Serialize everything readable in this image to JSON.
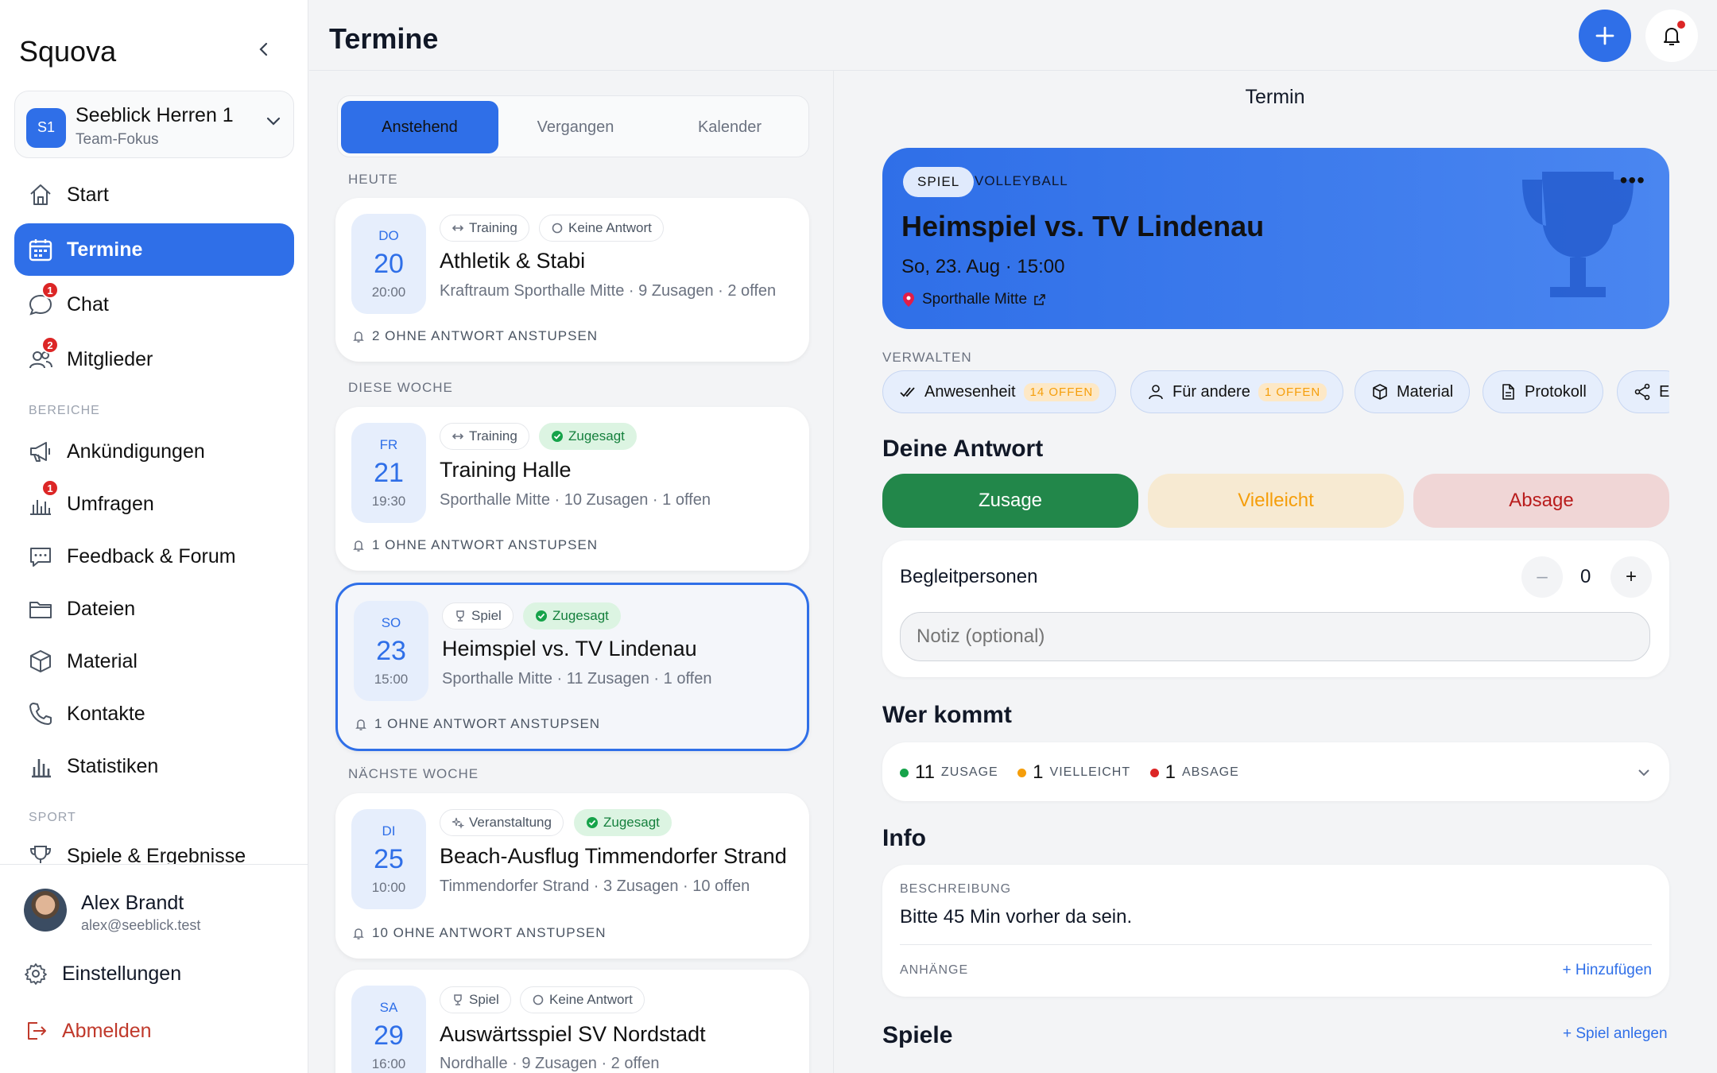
{
  "app": {
    "name": "Squova"
  },
  "team": {
    "badge": "S1",
    "name": "Seeblick Herren 1",
    "subtitle": "Team-Fokus"
  },
  "nav": {
    "items": [
      {
        "label": "Start",
        "icon": "home-icon"
      },
      {
        "label": "Termine",
        "icon": "calendar-icon",
        "active": true
      },
      {
        "label": "Chat",
        "icon": "chat-icon",
        "badge": "1"
      },
      {
        "label": "Mitglieder",
        "icon": "users-icon",
        "badge": "2"
      }
    ],
    "section_bereiche": "BEREICHE",
    "bereiche": [
      {
        "label": "Ankündigungen",
        "icon": "megaphone-icon"
      },
      {
        "label": "Umfragen",
        "icon": "poll-icon",
        "badge": "1"
      },
      {
        "label": "Feedback & Forum",
        "icon": "forum-icon"
      },
      {
        "label": "Dateien",
        "icon": "folder-icon"
      },
      {
        "label": "Material",
        "icon": "box-icon"
      },
      {
        "label": "Kontakte",
        "icon": "phone-icon"
      },
      {
        "label": "Statistiken",
        "icon": "stats-icon"
      }
    ],
    "section_sport": "SPORT",
    "sport": [
      {
        "label": "Spiele & Ergebnisse",
        "icon": "trophy-icon"
      }
    ]
  },
  "user": {
    "name": "Alex Brandt",
    "email": "alex@seeblick.test"
  },
  "bottom": {
    "settings": "Einstellungen",
    "logout": "Abmelden"
  },
  "header": {
    "title": "Termine"
  },
  "tabs": {
    "upcoming": "Anstehend",
    "past": "Vergangen",
    "calendar": "Kalender"
  },
  "groups": {
    "today": "HEUTE",
    "this_week": "DIESE WOCHE",
    "next_week": "NÄCHSTE WOCHE"
  },
  "events": [
    {
      "dow": "DO",
      "day": "20",
      "time": "20:00",
      "type": "Training",
      "status": "Keine Antwort",
      "title": "Athletik & Stabi",
      "meta": "Kraftraum Sporthalle Mitte · 9 Zusagen · 2 offen",
      "nudge": "2 OHNE ANTWORT ANSTUPSEN"
    },
    {
      "dow": "FR",
      "day": "21",
      "time": "19:30",
      "type": "Training",
      "status": "Zugesagt",
      "title": "Training Halle",
      "meta": "Sporthalle Mitte · 10 Zusagen · 1 offen",
      "nudge": "1 OHNE ANTWORT ANSTUPSEN"
    },
    {
      "dow": "SO",
      "day": "23",
      "time": "15:00",
      "type": "Spiel",
      "status": "Zugesagt",
      "title": "Heimspiel vs. TV Lindenau",
      "meta": "Sporthalle Mitte · 11 Zusagen · 1 offen",
      "nudge": "1 OHNE ANTWORT ANSTUPSEN"
    },
    {
      "dow": "DI",
      "day": "25",
      "time": "10:00",
      "type": "Veranstaltung",
      "status": "Zugesagt",
      "title": "Beach-Ausflug Timmendorfer Strand",
      "meta": "Timmendorfer Strand · 3 Zusagen · 10 offen",
      "nudge": "10 OHNE ANTWORT ANSTUPSEN"
    },
    {
      "dow": "SA",
      "day": "29",
      "time": "16:00",
      "type": "Spiel",
      "status": "Keine Antwort",
      "title": "Auswärtsspiel SV Nordstadt",
      "meta": "Nordhalle · 9 Zusagen · 2 offen"
    }
  ],
  "detail": {
    "heading": "Termin",
    "kind": "SPIEL",
    "sport": "VOLLEYBALL",
    "title": "Heimspiel vs. TV Lindenau",
    "datetime": "So, 23. Aug · 15:00",
    "location": "Sporthalle Mitte",
    "manage_label": "VERWALTEN",
    "actions": [
      {
        "label": "Anwesenheit",
        "count": "14 OFFEN",
        "icon": "check-icon"
      },
      {
        "label": "Für andere",
        "count": "1 OFFEN",
        "icon": "person-icon"
      },
      {
        "label": "Material",
        "icon": "box-icon"
      },
      {
        "label": "Protokoll",
        "icon": "document-icon"
      },
      {
        "label": "E",
        "icon": "share-icon"
      }
    ],
    "answer_heading": "Deine Antwort",
    "answers": {
      "yes": "Zusage",
      "maybe": "Vielleicht",
      "no": "Absage"
    },
    "companions_label": "Begleitpersonen",
    "companions_value": "0",
    "note_placeholder": "Notiz (optional)",
    "who_heading": "Wer kommt",
    "counts": {
      "yes_n": "11",
      "yes_l": "ZUSAGE",
      "maybe_n": "1",
      "maybe_l": "VIELLEICHT",
      "no_n": "1",
      "no_l": "ABSAGE"
    },
    "info_heading": "Info",
    "desc_label": "BESCHREIBUNG",
    "desc": "Bitte 45 Min vorher da sein.",
    "attach_label": "ANHÄNGE",
    "attach_add": "+ Hinzufügen",
    "games_heading": "Spiele",
    "games_add": "+ Spiel anlegen"
  },
  "colors": {
    "accent": "#2f6fe8",
    "yes": "#22874a",
    "maybe_bg": "#f7ead2",
    "maybe_text": "#f59e0b",
    "no_bg": "#f0d6d6",
    "no_text": "#b91c1c",
    "badge": "#dc2626"
  }
}
